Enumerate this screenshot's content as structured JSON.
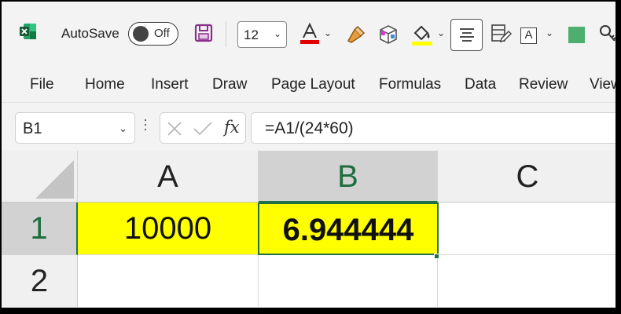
{
  "toolbar": {
    "autosave_label": "AutoSave",
    "autosave_state": "Off",
    "font_size": "12",
    "font_color": "#e00000",
    "highlight_color": "#ffff00",
    "textbox_letter": "A",
    "icons": [
      "excel-logo-icon",
      "save-icon",
      "font-color-icon",
      "format-painter-icon",
      "3d-object-icon",
      "fill-color-icon",
      "align-center-icon",
      "format-as-table-icon",
      "textbox-icon",
      "color-swatch-icon",
      "key-icon"
    ]
  },
  "ribbon": {
    "tabs": [
      "File",
      "Home",
      "Insert",
      "Draw",
      "Page Layout",
      "Formulas",
      "Data",
      "Review",
      "View"
    ]
  },
  "formula_bar": {
    "name_box": "B1",
    "fx_label": "fx",
    "formula": "=A1/(24*60)"
  },
  "sheet": {
    "columns": [
      "A",
      "B",
      "C"
    ],
    "rows": [
      "1",
      "2"
    ],
    "cells": {
      "A1": "10000",
      "B1": "6.944444"
    },
    "selected_cell": "B1",
    "cell_fill": "#ffff00"
  }
}
